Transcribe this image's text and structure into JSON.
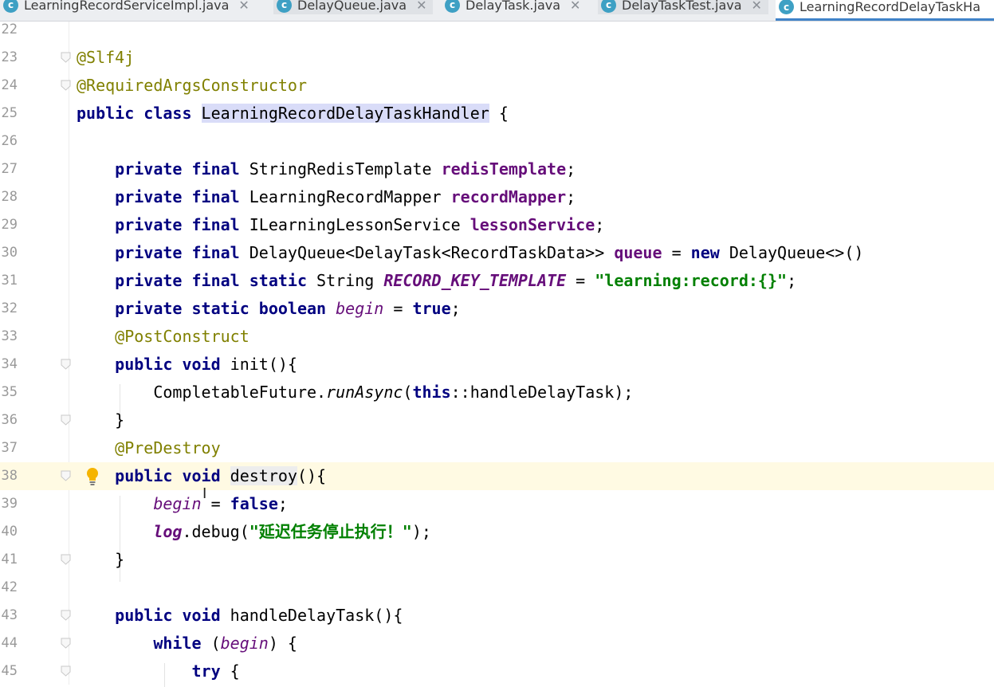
{
  "tabs": [
    {
      "label": "LearningRecordServiceImpl.java",
      "icon": "class-icon",
      "closable": true
    },
    {
      "label": "DelayQueue.java",
      "icon": "class-icon",
      "closable": true
    },
    {
      "label": "DelayTask.java",
      "icon": "class-icon",
      "closable": true
    },
    {
      "label": "DelayTaskTest.java",
      "icon": "class-icon",
      "closable": true
    },
    {
      "label": "LearningRecordDelayTaskHa",
      "icon": "class-icon",
      "closable": false,
      "active": true
    }
  ],
  "editor": {
    "caret_line": "38",
    "lines": [
      {
        "n": "22",
        "tokens": []
      },
      {
        "n": "23",
        "fold": true,
        "tokens": [
          {
            "t": "@Slf4j",
            "c": "ann"
          }
        ]
      },
      {
        "n": "24",
        "fold": true,
        "tokens": [
          {
            "t": "@RequiredArgsConstructor",
            "c": "ann"
          }
        ]
      },
      {
        "n": "25",
        "tokens": [
          {
            "t": "public class ",
            "c": "kw"
          },
          {
            "t": "LearningRecordDelayTaskHandler",
            "c": "pl hl-class"
          },
          {
            "t": " {",
            "c": "pl"
          }
        ]
      },
      {
        "n": "26",
        "tokens": []
      },
      {
        "n": "27",
        "tokens": [
          {
            "t": "    private final ",
            "c": "kw"
          },
          {
            "t": "StringRedisTemplate ",
            "c": "pl"
          },
          {
            "t": "redisTemplate",
            "c": "fld"
          },
          {
            "t": ";",
            "c": "pl"
          }
        ]
      },
      {
        "n": "28",
        "tokens": [
          {
            "t": "    private final ",
            "c": "kw"
          },
          {
            "t": "LearningRecordMapper ",
            "c": "pl"
          },
          {
            "t": "recordMapper",
            "c": "fld"
          },
          {
            "t": ";",
            "c": "pl"
          }
        ]
      },
      {
        "n": "29",
        "tokens": [
          {
            "t": "    private final ",
            "c": "kw"
          },
          {
            "t": "ILearningLessonService ",
            "c": "pl"
          },
          {
            "t": "lessonService",
            "c": "fld"
          },
          {
            "t": ";",
            "c": "pl"
          }
        ]
      },
      {
        "n": "30",
        "tokens": [
          {
            "t": "    private final ",
            "c": "kw"
          },
          {
            "t": "DelayQueue<DelayTask<RecordTaskData>> ",
            "c": "pl"
          },
          {
            "t": "queue",
            "c": "fld"
          },
          {
            "t": " = ",
            "c": "pl"
          },
          {
            "t": "new ",
            "c": "kw"
          },
          {
            "t": "DelayQueue<>()",
            "c": "pl"
          }
        ]
      },
      {
        "n": "31",
        "tokens": [
          {
            "t": "    private final static ",
            "c": "kw"
          },
          {
            "t": "String ",
            "c": "pl"
          },
          {
            "t": "RECORD_KEY_TEMPLATE",
            "c": "sfld"
          },
          {
            "t": " = ",
            "c": "pl"
          },
          {
            "t": "\"learning:record:{}\"",
            "c": "str"
          },
          {
            "t": ";",
            "c": "pl"
          }
        ]
      },
      {
        "n": "32",
        "tokens": [
          {
            "t": "    private static boolean ",
            "c": "kw"
          },
          {
            "t": "begin",
            "c": "svar"
          },
          {
            "t": " = ",
            "c": "pl"
          },
          {
            "t": "true",
            "c": "kw"
          },
          {
            "t": ";",
            "c": "pl"
          }
        ]
      },
      {
        "n": "33",
        "tokens": [
          {
            "t": "    @PostConstruct",
            "c": "ann"
          }
        ]
      },
      {
        "n": "34",
        "fold": true,
        "tokens": [
          {
            "t": "    public void ",
            "c": "kw"
          },
          {
            "t": "init(){",
            "c": "pl"
          }
        ]
      },
      {
        "n": "35",
        "tokens": [
          {
            "t": "        CompletableFuture.",
            "c": "pl"
          },
          {
            "t": "runAsync",
            "c": "pl ital"
          },
          {
            "t": "(",
            "c": "pl"
          },
          {
            "t": "this",
            "c": "kw"
          },
          {
            "t": "::handleDelayTask);",
            "c": "pl"
          }
        ]
      },
      {
        "n": "36",
        "fold": true,
        "tokens": [
          {
            "t": "    }",
            "c": "pl"
          }
        ]
      },
      {
        "n": "37",
        "tokens": [
          {
            "t": "    @PreDestroy",
            "c": "ann"
          }
        ]
      },
      {
        "n": "38",
        "fold": true,
        "bulb": true,
        "tokens": [
          {
            "t": "    public void ",
            "c": "kw"
          },
          {
            "t": "destroy",
            "c": "pl hl-ident"
          },
          {
            "t": "(){",
            "c": "pl"
          }
        ]
      },
      {
        "n": "39",
        "tokens": [
          {
            "t": "        ",
            "c": "pl"
          },
          {
            "t": "begin",
            "c": "svar"
          },
          {
            "t": " = ",
            "c": "pl"
          },
          {
            "t": "false",
            "c": "kw"
          },
          {
            "t": ";",
            "c": "pl"
          }
        ]
      },
      {
        "n": "40",
        "tokens": [
          {
            "t": "        ",
            "c": "pl"
          },
          {
            "t": "log",
            "c": "sfld"
          },
          {
            "t": ".debug(",
            "c": "pl"
          },
          {
            "t": "\"延迟任务停止执行！\"",
            "c": "str"
          },
          {
            "t": ");",
            "c": "pl"
          }
        ]
      },
      {
        "n": "41",
        "fold": true,
        "tokens": [
          {
            "t": "    }",
            "c": "pl"
          }
        ]
      },
      {
        "n": "42",
        "tokens": []
      },
      {
        "n": "43",
        "fold": true,
        "tokens": [
          {
            "t": "    public void ",
            "c": "kw"
          },
          {
            "t": "handleDelayTask(){",
            "c": "pl"
          }
        ]
      },
      {
        "n": "44",
        "fold": true,
        "tokens": [
          {
            "t": "        while ",
            "c": "kw"
          },
          {
            "t": "(",
            "c": "pl"
          },
          {
            "t": "begin",
            "c": "svar"
          },
          {
            "t": ") {",
            "c": "pl"
          }
        ]
      },
      {
        "n": "45",
        "fold": true,
        "tokens": [
          {
            "t": "            try ",
            "c": "kw"
          },
          {
            "t": "{",
            "c": "pl"
          }
        ]
      }
    ]
  }
}
